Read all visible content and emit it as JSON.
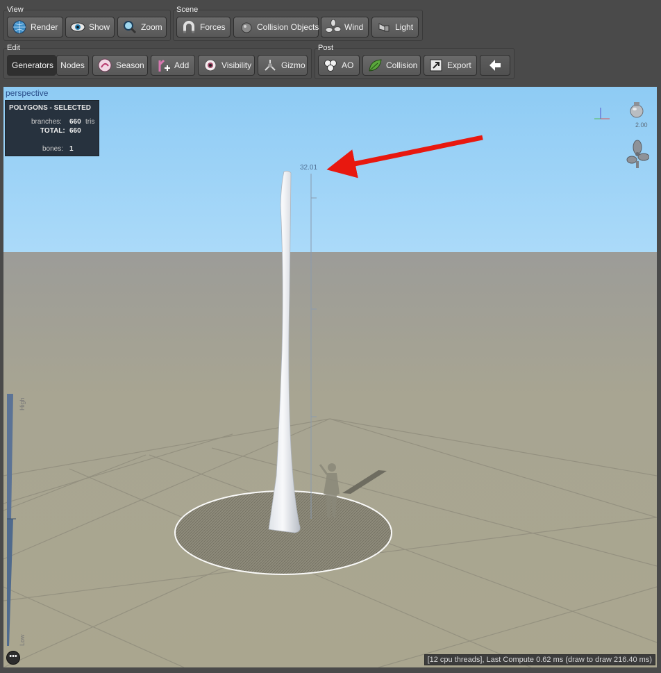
{
  "toolbar": {
    "view": {
      "title": "View",
      "render": "Render",
      "show": "Show",
      "zoom": "Zoom"
    },
    "scene": {
      "title": "Scene",
      "forces": "Forces",
      "collision_objects": "Collision Objects",
      "wind": "Wind",
      "light": "Light"
    },
    "edit": {
      "title": "Edit",
      "generators": "Generators",
      "nodes": "Nodes",
      "season": "Season",
      "add": "Add",
      "visibility": "Visibility",
      "gizmo": "Gizmo"
    },
    "post": {
      "title": "Post",
      "ao": "AO",
      "collision": "Collision",
      "export": "Export"
    }
  },
  "viewport": {
    "label": "perspective",
    "stats": {
      "title": "POLYGONS - SELECTED",
      "branches_label": "branches:",
      "branches_value": "660",
      "branches_unit": "tris",
      "total_label": "TOTAL:",
      "total_value": "660",
      "bones_label": "bones:",
      "bones_value": "1"
    },
    "height_marker": "32.01",
    "light_intensity": "2.00",
    "lod_high": "High",
    "lod_low": "Low",
    "more_label": "•••",
    "status": "[12 cpu threads], Last Compute 0.62 ms (draw to draw 216.40 ms)"
  },
  "colors": {
    "sky_top": "#8ecbf4",
    "sky_bottom": "#a9d8f8",
    "ground": "#a7a490",
    "arrow": "#e8180f",
    "panel_bg": "#4d4d4d"
  }
}
